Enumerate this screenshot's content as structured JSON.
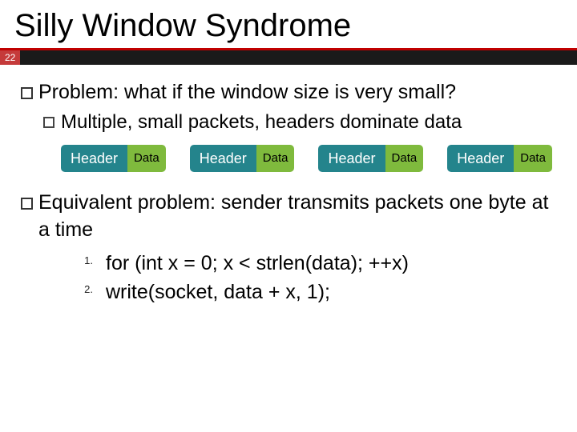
{
  "slide": {
    "title": "Silly Window Syndrome",
    "page_number": "22",
    "bullets": {
      "problem": "Problem: what if the window size is very small?",
      "problem_sub": "Multiple, small packets, headers dominate data",
      "equivalent": "Equivalent problem: sender transmits packets one byte at a time",
      "code1": "for (int x = 0; x < strlen(data); ++x)",
      "code2": "write(socket, data + x, 1);"
    },
    "packet_labels": {
      "header": "Header",
      "data": "Data"
    }
  }
}
